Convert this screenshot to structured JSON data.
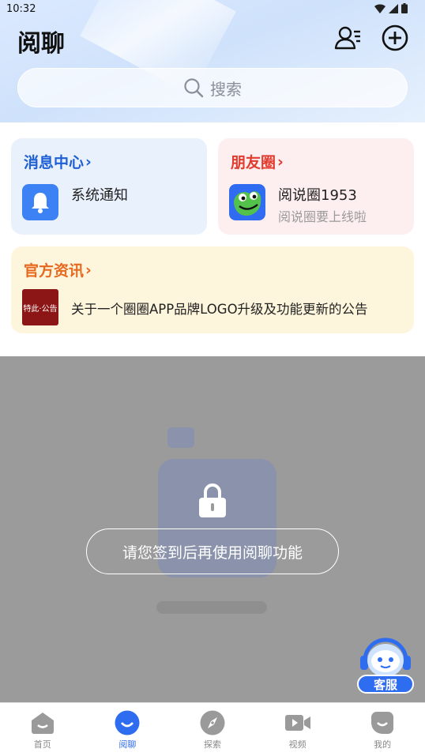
{
  "status_bar": {
    "time": "10:32"
  },
  "header": {
    "title": "阅聊"
  },
  "search": {
    "label": "搜索"
  },
  "message_center": {
    "title": "消息中心",
    "item_label": "系统通知"
  },
  "moments": {
    "title": "朋友圈",
    "name": "阅说圈1953",
    "subtitle": "阅说圈要上线啦"
  },
  "news": {
    "title": "官方资讯",
    "thumb_text": "特此·公告",
    "headline": "关于一个圈圈APP品牌LOGO升级及功能更新的公告"
  },
  "lock_overlay": {
    "message": "请您签到后再使用阅聊功能"
  },
  "customer_service": {
    "label": "客服"
  },
  "tabbar": {
    "tabs": [
      {
        "label": "首页",
        "icon": "home-icon"
      },
      {
        "label": "阅聊",
        "icon": "chat-icon"
      },
      {
        "label": "探索",
        "icon": "compass-icon"
      },
      {
        "label": "视频",
        "icon": "video-icon"
      },
      {
        "label": "我的",
        "icon": "profile-icon"
      }
    ],
    "active": "阅聊"
  },
  "colors": {
    "accent": "#2e6cf0",
    "message_title": "#1f5fd6",
    "moments_title": "#e23b2e",
    "news_title": "#e5691f"
  }
}
